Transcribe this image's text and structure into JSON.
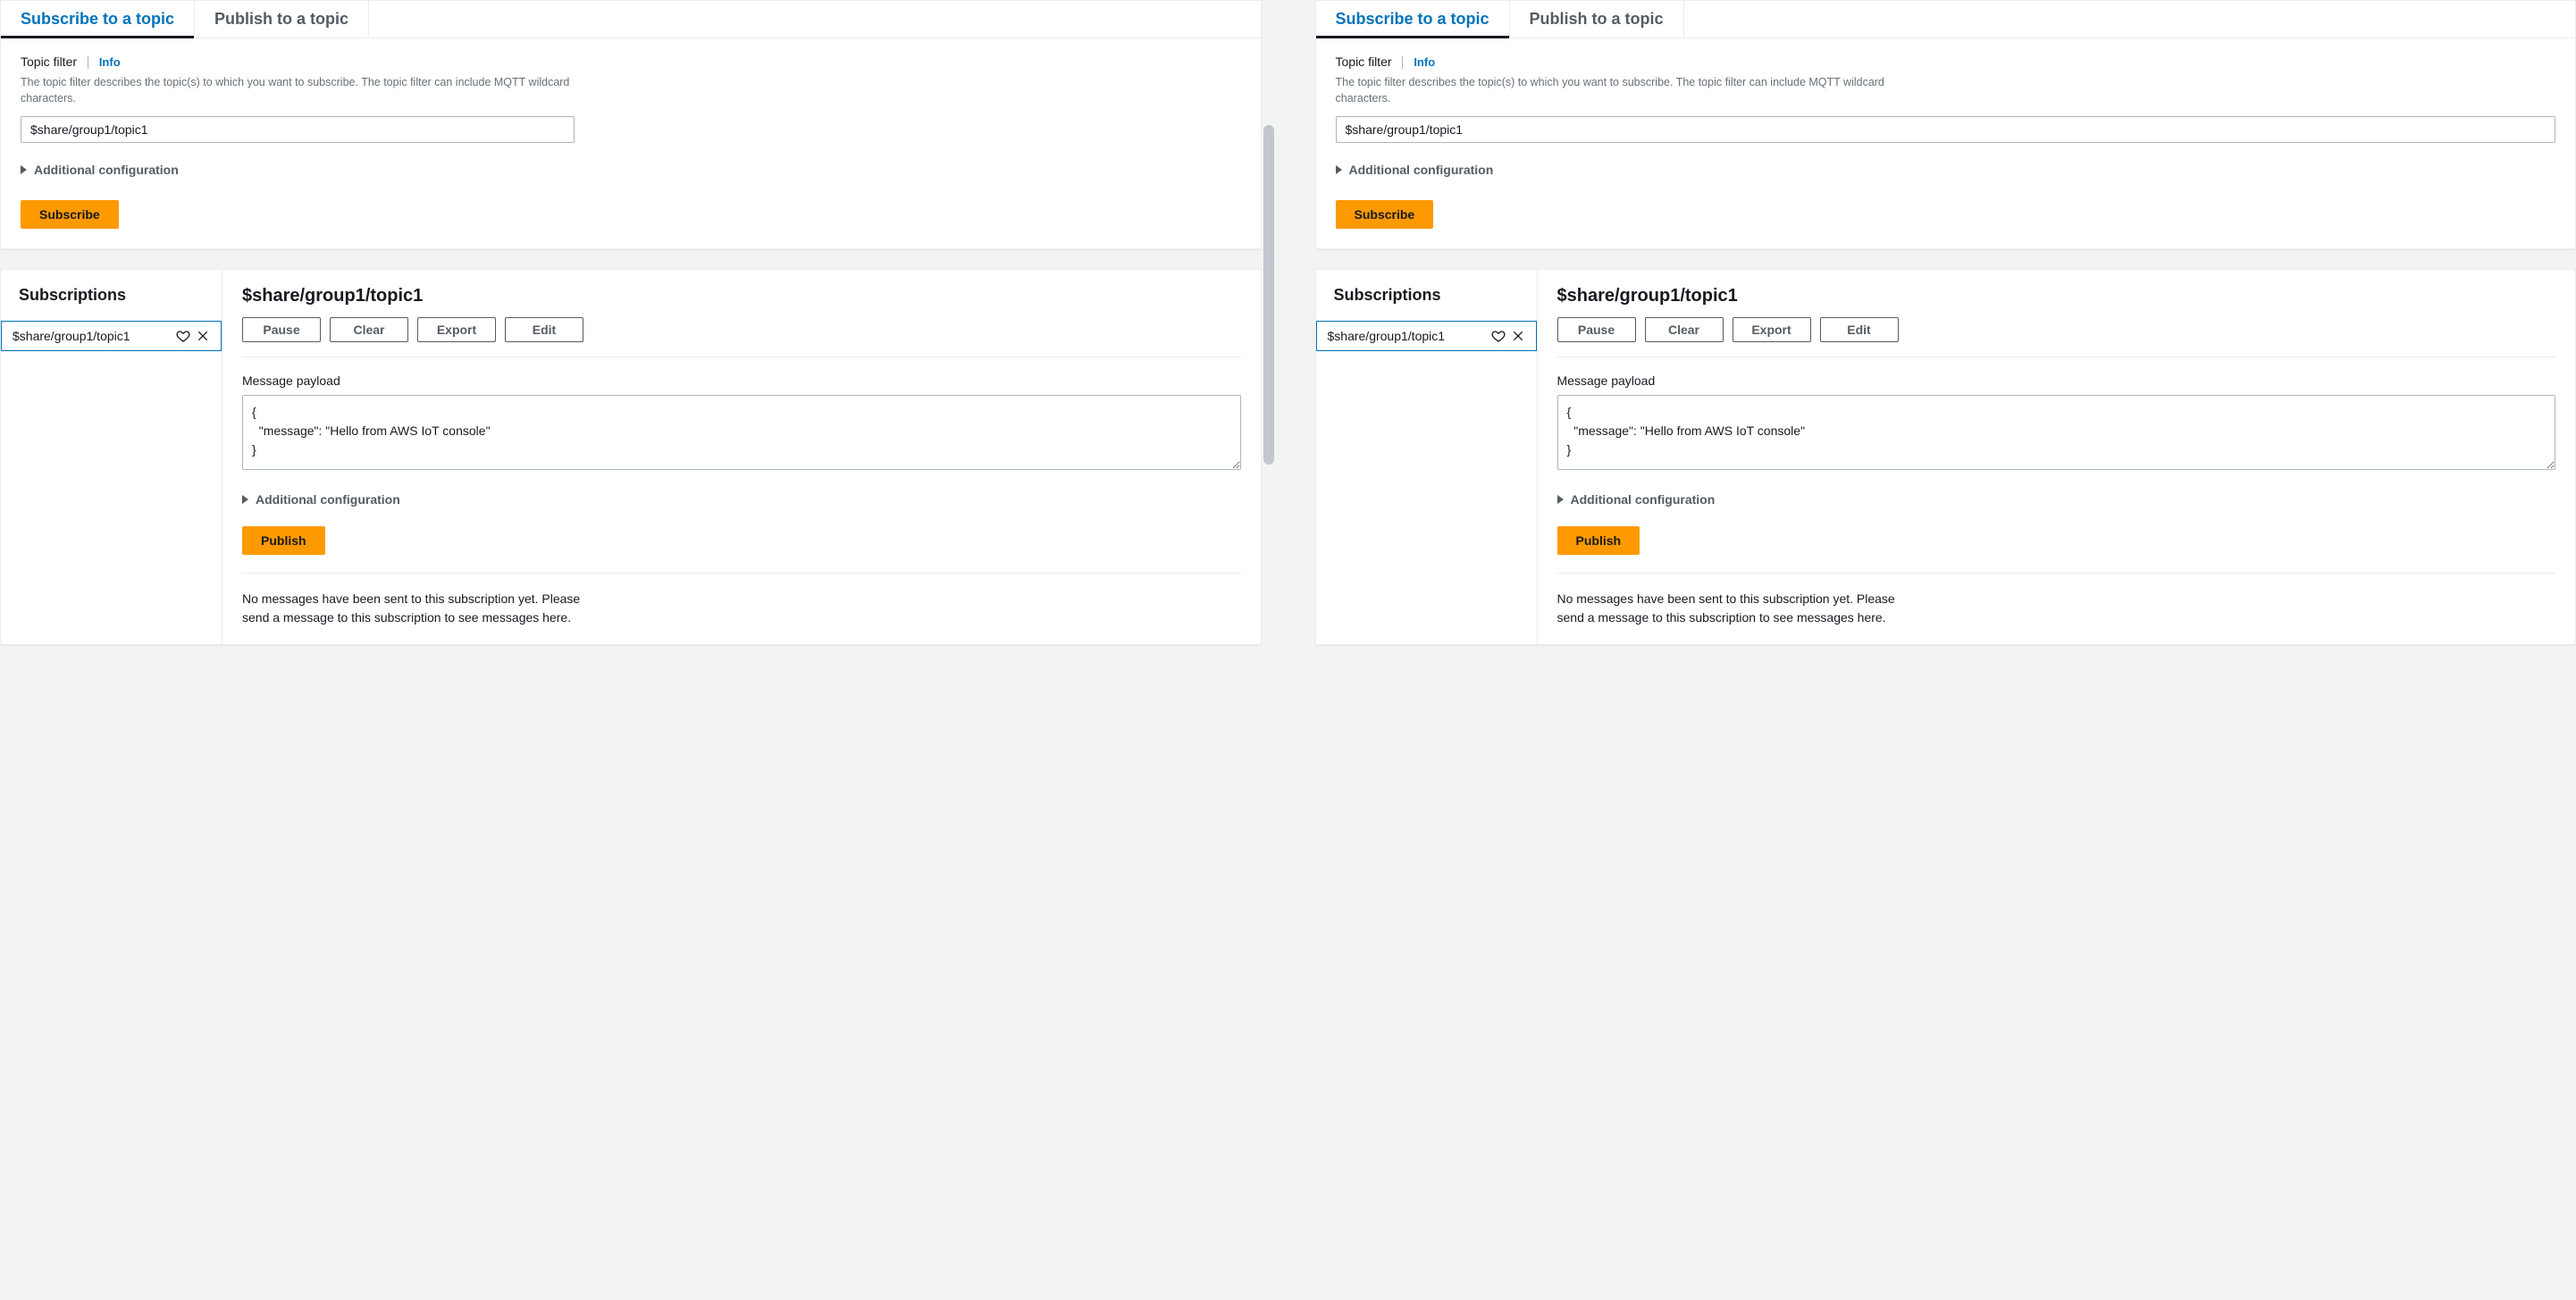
{
  "tabs": {
    "subscribe": "Subscribe to a topic",
    "publish": "Publish to a topic"
  },
  "topicFilter": {
    "label": "Topic filter",
    "info": "Info",
    "desc": "The topic filter describes the topic(s) to which you want to subscribe. The topic filter can include MQTT wildcard characters.",
    "value": "$share/group1/topic1"
  },
  "additionalConfig": "Additional configuration",
  "subscribeBtn": "Subscribe",
  "subscriptions": {
    "title": "Subscriptions",
    "items": [
      {
        "name": "$share/group1/topic1"
      }
    ]
  },
  "detail": {
    "title": "$share/group1/topic1",
    "buttons": {
      "pause": "Pause",
      "clear": "Clear",
      "export": "Export",
      "edit": "Edit"
    },
    "payloadLabel": "Message payload",
    "payloadValue": "{\n  \"message\": \"Hello from AWS IoT console\"\n}",
    "additionalConfig": "Additional configuration",
    "publishBtn": "Publish",
    "noMessages": "No messages have been sent to this subscription yet. Please send a message to this subscription to see messages here."
  }
}
